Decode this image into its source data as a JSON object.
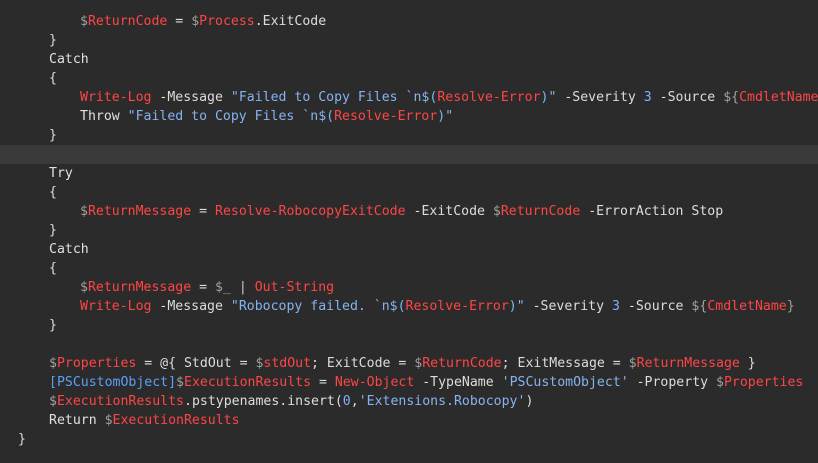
{
  "colors": {
    "background": "#2b2b2b",
    "current_line": "#3a3a3a",
    "default": "#dcdcdc",
    "variable": "#ff4545",
    "dollar": "#a0a0a0",
    "keyword": "#e0e0e0",
    "string": "#86b3f0",
    "number": "#7fb0ff",
    "type": "#5d9ef7",
    "operator": "#c8c8c8"
  },
  "editor": {
    "lines": [
      {
        "indent": 2,
        "tokens": [
          {
            "t": "$",
            "c": "dollar"
          },
          {
            "t": "ReturnCode",
            "c": "variable"
          },
          {
            "t": " = ",
            "c": "default"
          },
          {
            "t": "$",
            "c": "dollar"
          },
          {
            "t": "Process",
            "c": "variable"
          },
          {
            "t": ".ExitCode",
            "c": "default"
          }
        ]
      },
      {
        "indent": 1,
        "tokens": [
          {
            "t": "}",
            "c": "default"
          }
        ]
      },
      {
        "indent": 1,
        "tokens": [
          {
            "t": "Catch",
            "c": "keyword"
          }
        ]
      },
      {
        "indent": 1,
        "tokens": [
          {
            "t": "{",
            "c": "default"
          }
        ]
      },
      {
        "indent": 2,
        "tokens": [
          {
            "t": "Write-Log",
            "c": "variable"
          },
          {
            "t": " -Message ",
            "c": "default"
          },
          {
            "t": "\"Failed to Copy Files `n$(",
            "c": "string"
          },
          {
            "t": "Resolve-Error",
            "c": "variable"
          },
          {
            "t": ")\"",
            "c": "string"
          },
          {
            "t": " -Severity ",
            "c": "default"
          },
          {
            "t": "3",
            "c": "number"
          },
          {
            "t": " -Source ",
            "c": "default"
          },
          {
            "t": "${",
            "c": "dollar"
          },
          {
            "t": "CmdletName",
            "c": "variable"
          },
          {
            "t": "}",
            "c": "dollar"
          }
        ]
      },
      {
        "indent": 2,
        "tokens": [
          {
            "t": "Throw ",
            "c": "keyword"
          },
          {
            "t": "\"Failed to Copy Files `n$(",
            "c": "string"
          },
          {
            "t": "Resolve-Error",
            "c": "variable"
          },
          {
            "t": ")\"",
            "c": "string"
          }
        ]
      },
      {
        "indent": 1,
        "tokens": [
          {
            "t": "}",
            "c": "default"
          }
        ]
      },
      {
        "indent": 0,
        "current": true,
        "tokens": []
      },
      {
        "indent": 1,
        "tokens": [
          {
            "t": "Try",
            "c": "keyword"
          }
        ]
      },
      {
        "indent": 1,
        "tokens": [
          {
            "t": "{",
            "c": "default"
          }
        ]
      },
      {
        "indent": 2,
        "tokens": [
          {
            "t": "$",
            "c": "dollar"
          },
          {
            "t": "ReturnMessage",
            "c": "variable"
          },
          {
            "t": " = ",
            "c": "default"
          },
          {
            "t": "Resolve-RobocopyExitCode",
            "c": "variable"
          },
          {
            "t": " -ExitCode ",
            "c": "default"
          },
          {
            "t": "$",
            "c": "dollar"
          },
          {
            "t": "ReturnCode",
            "c": "variable"
          },
          {
            "t": " -ErrorAction Stop",
            "c": "default"
          }
        ]
      },
      {
        "indent": 1,
        "tokens": [
          {
            "t": "}",
            "c": "default"
          }
        ]
      },
      {
        "indent": 1,
        "tokens": [
          {
            "t": "Catch",
            "c": "keyword"
          }
        ]
      },
      {
        "indent": 1,
        "tokens": [
          {
            "t": "{",
            "c": "default"
          }
        ]
      },
      {
        "indent": 2,
        "tokens": [
          {
            "t": "$",
            "c": "dollar"
          },
          {
            "t": "ReturnMessage",
            "c": "variable"
          },
          {
            "t": " = ",
            "c": "default"
          },
          {
            "t": "$_",
            "c": "dollar"
          },
          {
            "t": " | ",
            "c": "operator"
          },
          {
            "t": "Out-String",
            "c": "variable"
          }
        ]
      },
      {
        "indent": 2,
        "tokens": [
          {
            "t": "Write-Log",
            "c": "variable"
          },
          {
            "t": " -Message ",
            "c": "default"
          },
          {
            "t": "\"Robocopy failed. `n$(",
            "c": "string"
          },
          {
            "t": "Resolve-Error",
            "c": "variable"
          },
          {
            "t": ")\"",
            "c": "string"
          },
          {
            "t": " -Severity ",
            "c": "default"
          },
          {
            "t": "3",
            "c": "number"
          },
          {
            "t": " -Source ",
            "c": "default"
          },
          {
            "t": "${",
            "c": "dollar"
          },
          {
            "t": "CmdletName",
            "c": "variable"
          },
          {
            "t": "}",
            "c": "dollar"
          }
        ]
      },
      {
        "indent": 1,
        "tokens": [
          {
            "t": "}",
            "c": "default"
          }
        ]
      },
      {
        "indent": 0,
        "tokens": []
      },
      {
        "indent": 1,
        "tokens": [
          {
            "t": "$",
            "c": "dollar"
          },
          {
            "t": "Properties",
            "c": "variable"
          },
          {
            "t": " = @{ StdOut = ",
            "c": "default"
          },
          {
            "t": "$",
            "c": "dollar"
          },
          {
            "t": "stdOut",
            "c": "variable"
          },
          {
            "t": "; ExitCode = ",
            "c": "default"
          },
          {
            "t": "$",
            "c": "dollar"
          },
          {
            "t": "ReturnCode",
            "c": "variable"
          },
          {
            "t": "; ExitMessage = ",
            "c": "default"
          },
          {
            "t": "$",
            "c": "dollar"
          },
          {
            "t": "ReturnMessage",
            "c": "variable"
          },
          {
            "t": " }",
            "c": "default"
          }
        ]
      },
      {
        "indent": 1,
        "tokens": [
          {
            "t": "[PSCustomObject]",
            "c": "type"
          },
          {
            "t": "$",
            "c": "dollar"
          },
          {
            "t": "ExecutionResults",
            "c": "variable"
          },
          {
            "t": " = ",
            "c": "default"
          },
          {
            "t": "New-Object",
            "c": "variable"
          },
          {
            "t": " -TypeName ",
            "c": "default"
          },
          {
            "t": "'PSCustomObject'",
            "c": "string"
          },
          {
            "t": " -Property ",
            "c": "default"
          },
          {
            "t": "$",
            "c": "dollar"
          },
          {
            "t": "Properties",
            "c": "variable"
          }
        ]
      },
      {
        "indent": 1,
        "tokens": [
          {
            "t": "$",
            "c": "dollar"
          },
          {
            "t": "ExecutionResults",
            "c": "variable"
          },
          {
            "t": ".pstypenames.insert(",
            "c": "default"
          },
          {
            "t": "0",
            "c": "number"
          },
          {
            "t": ",",
            "c": "default"
          },
          {
            "t": "'Extensions.Robocopy'",
            "c": "string"
          },
          {
            "t": ")",
            "c": "default"
          }
        ]
      },
      {
        "indent": 1,
        "tokens": [
          {
            "t": "Return ",
            "c": "keyword"
          },
          {
            "t": "$",
            "c": "dollar"
          },
          {
            "t": "ExecutionResults",
            "c": "variable"
          }
        ]
      },
      {
        "indent": 0,
        "tokens": [
          {
            "t": "}",
            "c": "default"
          }
        ]
      }
    ]
  }
}
